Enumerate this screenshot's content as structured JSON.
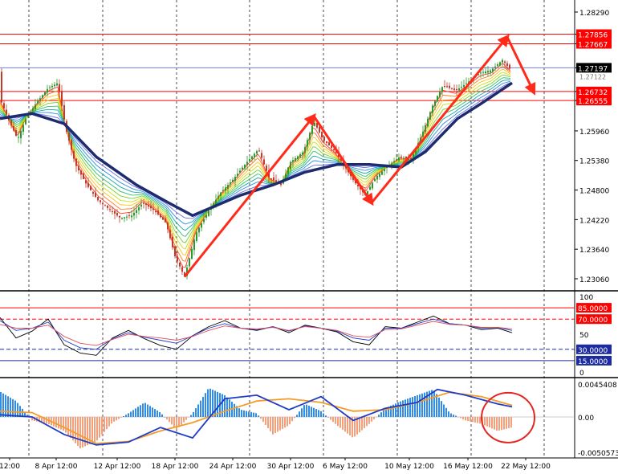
{
  "chart_data": [
    {
      "type": "candlestick",
      "panel": "price",
      "yticks": [
        1.2306,
        1.2364,
        1.2422,
        1.248,
        1.2538,
        1.2596,
        1.26732,
        1.26555,
        1.27197,
        1.27667,
        1.27856,
        1.2829
      ],
      "ytick_labels": [
        "1.23060",
        "1.23640",
        "1.24220",
        "1.24800",
        "1.25380",
        "1.25960",
        "1.26732",
        "1.26555",
        "1.27197",
        "1.27667",
        "1.27856",
        "1.28290"
      ],
      "current_price_label": "1.27197",
      "hidden_label": "1.27122",
      "horizontal_levels": [
        {
          "price": 1.27856,
          "label": "1.27856",
          "color": "#ff0000"
        },
        {
          "price": 1.27667,
          "label": "1.27667",
          "color": "#ff0000"
        },
        {
          "price": 1.27197,
          "label": "1.27197",
          "color": "#6f7fd8"
        },
        {
          "price": 1.26732,
          "label": "1.26732",
          "color": "#ff0000"
        },
        {
          "price": 1.26555,
          "label": "1.26555",
          "color": "#ff0000"
        }
      ],
      "close_path": [
        [
          0,
          1.266
        ],
        [
          10,
          1.262
        ],
        [
          22,
          1.258
        ],
        [
          32,
          1.262
        ],
        [
          45,
          1.265
        ],
        [
          60,
          1.268
        ],
        [
          72,
          1.269
        ],
        [
          82,
          1.26
        ],
        [
          94,
          1.253
        ],
        [
          108,
          1.249
        ],
        [
          122,
          1.246
        ],
        [
          138,
          1.244
        ],
        [
          150,
          1.2425
        ],
        [
          164,
          1.243
        ],
        [
          178,
          1.2455
        ],
        [
          192,
          1.244
        ],
        [
          207,
          1.2415
        ],
        [
          218,
          1.235
        ],
        [
          230,
          1.231
        ],
        [
          244,
          1.2395
        ],
        [
          260,
          1.244
        ],
        [
          275,
          1.2475
        ],
        [
          290,
          1.25
        ],
        [
          305,
          1.253
        ],
        [
          322,
          1.256
        ],
        [
          335,
          1.2505
        ],
        [
          350,
          1.249
        ],
        [
          362,
          1.2535
        ],
        [
          378,
          1.2555
        ],
        [
          391,
          1.2615
        ],
        [
          402,
          1.258
        ],
        [
          418,
          1.2555
        ],
        [
          430,
          1.2525
        ],
        [
          442,
          1.2495
        ],
        [
          455,
          1.247
        ],
        [
          468,
          1.2505
        ],
        [
          482,
          1.2525
        ],
        [
          498,
          1.2545
        ],
        [
          512,
          1.254
        ],
        [
          526,
          1.259
        ],
        [
          540,
          1.265
        ],
        [
          552,
          1.2685
        ],
        [
          568,
          1.2675
        ],
        [
          582,
          1.269
        ],
        [
          598,
          1.271
        ],
        [
          612,
          1.2715
        ],
        [
          626,
          1.2735
        ],
        [
          638,
          1.2712
        ]
      ],
      "slow_ma_path": [
        [
          0,
          1.262
        ],
        [
          40,
          1.263
        ],
        [
          80,
          1.261
        ],
        [
          120,
          1.2545
        ],
        [
          170,
          1.249
        ],
        [
          210,
          1.2455
        ],
        [
          240,
          1.243
        ],
        [
          270,
          1.245
        ],
        [
          300,
          1.247
        ],
        [
          340,
          1.249
        ],
        [
          380,
          1.2515
        ],
        [
          420,
          1.253
        ],
        [
          460,
          1.253
        ],
        [
          500,
          1.2525
        ],
        [
          530,
          1.2555
        ],
        [
          570,
          1.262
        ],
        [
          600,
          1.265
        ],
        [
          638,
          1.269
        ]
      ],
      "arrows": [
        {
          "from": [
            230,
            1.231
          ],
          "to": [
            391,
            1.2625
          ]
        },
        {
          "from": [
            391,
            1.2625
          ],
          "to": [
            463,
            1.2455
          ]
        },
        {
          "from": [
            463,
            1.2455
          ],
          "to": [
            632,
            1.278
          ]
        },
        {
          "from": [
            632,
            1.278
          ],
          "to": [
            665,
            1.2672
          ]
        }
      ]
    },
    {
      "type": "line",
      "panel": "oscillator",
      "ylim": [
        0,
        100
      ],
      "yticks": [
        0,
        15,
        30,
        50,
        70,
        85,
        100
      ],
      "ytick_labels": [
        "0",
        "15.0000",
        "30.0000",
        "50",
        "70.0000",
        "85.0000",
        "100"
      ],
      "levels": [
        {
          "value": 85,
          "label": "85.0000"
        },
        {
          "value": 70,
          "label": "70.0000"
        },
        {
          "value": 30,
          "label": "30.0000"
        },
        {
          "value": 15,
          "label": "15.0000"
        }
      ],
      "series": [
        {
          "color": "#000000",
          "points": [
            [
              0,
              72
            ],
            [
              20,
              45
            ],
            [
              40,
              54
            ],
            [
              60,
              70
            ],
            [
              80,
              36
            ],
            [
              100,
              25
            ],
            [
              120,
              22
            ],
            [
              140,
              45
            ],
            [
              160,
              55
            ],
            [
              180,
              44
            ],
            [
              200,
              35
            ],
            [
              220,
              30
            ],
            [
              240,
              48
            ],
            [
              260,
              60
            ],
            [
              280,
              68
            ],
            [
              300,
              58
            ],
            [
              320,
              55
            ],
            [
              340,
              60
            ],
            [
              360,
              52
            ],
            [
              380,
              62
            ],
            [
              400,
              58
            ],
            [
              420,
              53
            ],
            [
              440,
              40
            ],
            [
              460,
              36
            ],
            [
              480,
              60
            ],
            [
              500,
              58
            ],
            [
              520,
              66
            ],
            [
              540,
              74
            ],
            [
              560,
              64
            ],
            [
              580,
              62
            ],
            [
              600,
              56
            ],
            [
              620,
              58
            ],
            [
              638,
              52
            ]
          ]
        },
        {
          "color": "#1f3cc7",
          "points": [
            [
              0,
              68
            ],
            [
              20,
              55
            ],
            [
              40,
              58
            ],
            [
              60,
              66
            ],
            [
              80,
              42
            ],
            [
              100,
              32
            ],
            [
              120,
              30
            ],
            [
              140,
              44
            ],
            [
              160,
              52
            ],
            [
              180,
              46
            ],
            [
              200,
              42
            ],
            [
              220,
              38
            ],
            [
              240,
              48
            ],
            [
              260,
              58
            ],
            [
              280,
              64
            ],
            [
              300,
              58
            ],
            [
              320,
              56
            ],
            [
              340,
              60
            ],
            [
              360,
              54
            ],
            [
              380,
              61
            ],
            [
              400,
              58
            ],
            [
              420,
              54
            ],
            [
              440,
              45
            ],
            [
              460,
              42
            ],
            [
              480,
              58
            ],
            [
              500,
              58
            ],
            [
              520,
              64
            ],
            [
              540,
              70
            ],
            [
              560,
              64
            ],
            [
              580,
              62
            ],
            [
              600,
              58
            ],
            [
              620,
              59
            ],
            [
              638,
              55
            ]
          ]
        },
        {
          "color": "#e0505a",
          "points": [
            [
              0,
              63
            ],
            [
              20,
              58
            ],
            [
              40,
              58
            ],
            [
              60,
              62
            ],
            [
              80,
              47
            ],
            [
              100,
              38
            ],
            [
              120,
              35
            ],
            [
              140,
              43
            ],
            [
              160,
              50
            ],
            [
              180,
              47
            ],
            [
              200,
              45
            ],
            [
              220,
              42
            ],
            [
              240,
              47
            ],
            [
              260,
              55
            ],
            [
              280,
              61
            ],
            [
              300,
              58
            ],
            [
              320,
              57
            ],
            [
              340,
              59
            ],
            [
              360,
              55
            ],
            [
              380,
              60
            ],
            [
              400,
              58
            ],
            [
              420,
              55
            ],
            [
              440,
              48
            ],
            [
              460,
              46
            ],
            [
              480,
              56
            ],
            [
              500,
              57
            ],
            [
              520,
              62
            ],
            [
              540,
              67
            ],
            [
              560,
              63
            ],
            [
              580,
              62
            ],
            [
              600,
              59
            ],
            [
              620,
              59
            ],
            [
              638,
              57
            ]
          ]
        }
      ]
    },
    {
      "type": "bar",
      "panel": "macd",
      "ylim": [
        -0.0050573,
        0.0045408
      ],
      "yticks": [
        -0.0050573,
        0.0,
        0.0045408
      ],
      "ytick_labels": [
        "-0.0050573",
        "0.00",
        "0.0045408"
      ],
      "histogram": [
        [
          0,
          0.0035
        ],
        [
          20,
          0.0022
        ],
        [
          40,
          -0.0005
        ],
        [
          60,
          -0.001
        ],
        [
          80,
          -0.002
        ],
        [
          100,
          -0.0045
        ],
        [
          120,
          -0.0035
        ],
        [
          140,
          -0.0008
        ],
        [
          160,
          0.0005
        ],
        [
          180,
          0.002
        ],
        [
          200,
          0.0006
        ],
        [
          220,
          -0.0018
        ],
        [
          240,
          0.0005
        ],
        [
          260,
          0.004
        ],
        [
          280,
          0.003
        ],
        [
          300,
          0.001
        ],
        [
          320,
          0.0005
        ],
        [
          340,
          -0.0025
        ],
        [
          360,
          -0.0012
        ],
        [
          380,
          0.0018
        ],
        [
          400,
          0.0008
        ],
        [
          420,
          -0.0012
        ],
        [
          440,
          -0.003
        ],
        [
          460,
          -0.001
        ],
        [
          480,
          0.0012
        ],
        [
          500,
          0.0022
        ],
        [
          520,
          0.003
        ],
        [
          540,
          0.0038
        ],
        [
          560,
          0.0006
        ],
        [
          580,
          -0.0005
        ],
        [
          600,
          -0.001
        ],
        [
          620,
          -0.002
        ],
        [
          638,
          -0.0015
        ]
      ],
      "signal_line": [
        [
          0,
          0.0008
        ],
        [
          40,
          0.0006
        ],
        [
          80,
          -0.0015
        ],
        [
          120,
          -0.0038
        ],
        [
          160,
          -0.0035
        ],
        [
          200,
          -0.002
        ],
        [
          240,
          -0.0008
        ],
        [
          280,
          0.0008
        ],
        [
          320,
          0.0022
        ],
        [
          360,
          0.0025
        ],
        [
          400,
          0.002
        ],
        [
          440,
          0.0008
        ],
        [
          480,
          0.001
        ],
        [
          520,
          0.002
        ],
        [
          560,
          0.0034
        ],
        [
          600,
          0.0028
        ],
        [
          638,
          0.0016
        ]
      ],
      "macd_line": [
        [
          0,
          0.0003
        ],
        [
          40,
          0.0
        ],
        [
          80,
          -0.0025
        ],
        [
          120,
          -0.004
        ],
        [
          160,
          -0.0036
        ],
        [
          200,
          -0.0015
        ],
        [
          240,
          -0.003
        ],
        [
          280,
          0.0025
        ],
        [
          320,
          0.003
        ],
        [
          360,
          0.001
        ],
        [
          400,
          0.0028
        ],
        [
          440,
          -0.0005
        ],
        [
          480,
          0.0012
        ],
        [
          520,
          0.002
        ],
        [
          545,
          0.0038
        ],
        [
          580,
          0.003
        ],
        [
          620,
          0.0018
        ],
        [
          638,
          0.0014
        ]
      ],
      "highlight_circle_center": [
        633,
        -0.0001
      ]
    }
  ],
  "time_axis": {
    "labels": [
      "12:00",
      "8 Apr 12:00",
      "12 Apr 12:00",
      "18 Apr 12:00",
      "24 Apr 12:00",
      "30 Apr 12:00",
      "6 May 12:00",
      "10 May 12:00",
      "16 May 12:00",
      "22 May 12:00"
    ],
    "label_indices": [
      0,
      1,
      2,
      3,
      4,
      5,
      6,
      7,
      8,
      9
    ]
  },
  "colors": {
    "background": "#ffffff",
    "grid": "#000000",
    "price_axis_text": "#000000",
    "up_candle": "#2a9a2a",
    "down_candle": "#c13a2a",
    "slow_ma": "#1d2b6f",
    "arrow": "#ff2a1a",
    "level_red": "#ff0000",
    "level_blue": "#6f7fd8",
    "histogram_pos": "#2f8de8",
    "histogram_neg": "#f5a07a",
    "macd_signal": "#1f3cc7",
    "macd_orange": "#f39c28",
    "circle": "#e52424"
  }
}
